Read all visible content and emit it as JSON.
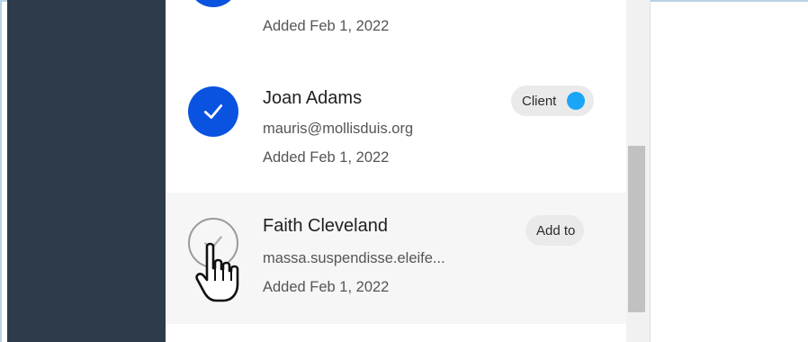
{
  "contacts": [
    {
      "email": "",
      "added": "Added Feb 1, 2022",
      "selected": true
    },
    {
      "name": "Joan Adams",
      "email": "mauris@mollisduis.org",
      "added": "Added Feb 1, 2022",
      "selected": true,
      "badge": "Client",
      "badge_dot_color": "#1aa6f7"
    },
    {
      "name": "Faith Cleveland",
      "email": "massa.suspendisse.eleife...",
      "added": "Added Feb 1, 2022",
      "selected": false,
      "badge": "Add to"
    }
  ],
  "colors": {
    "sidebar": "#2d3b4a",
    "selected_check": "#0a52e0",
    "hover_row": "#f6f6f6"
  },
  "icons": {
    "check": "check-icon",
    "cursor": "hand-pointer-cursor"
  }
}
